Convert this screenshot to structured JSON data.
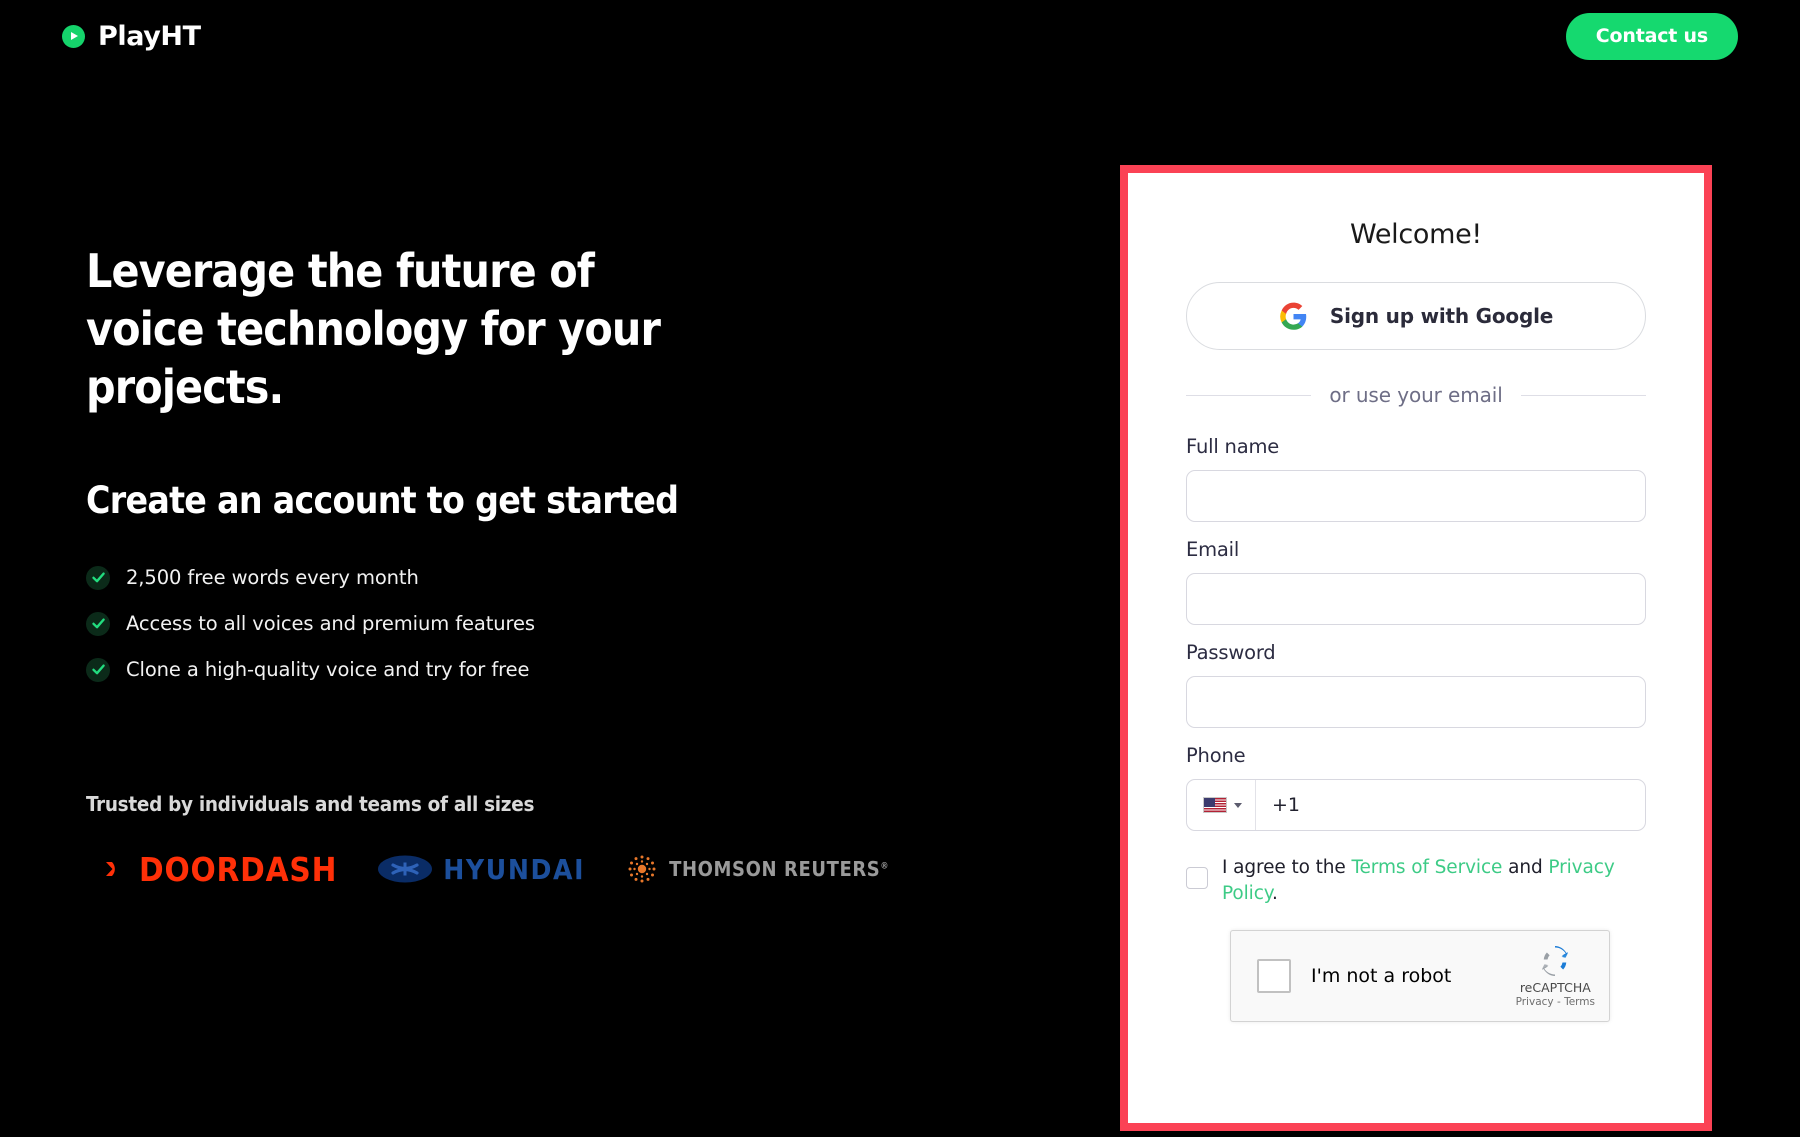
{
  "header": {
    "brand_name": "PlayHT",
    "contact_label": "Contact us"
  },
  "hero": {
    "headline": "Leverage the future of voice technology for your projects.",
    "subheadline": "Create an account to get started",
    "features": [
      "2,500 free words every month",
      "Access to all voices and premium features",
      "Clone a high-quality voice and try for free"
    ],
    "trusted_title": "Trusted by individuals and teams of all sizes",
    "logos": [
      {
        "name": "DoorDash",
        "text": "DOORDASH",
        "color": "#FF3008"
      },
      {
        "name": "Hyundai",
        "text": "HYUNDAI",
        "color": "#1C4F9C"
      },
      {
        "name": "Thomson Reuters",
        "text": "THOMSON REUTERS",
        "color": "#9A9A9A"
      }
    ]
  },
  "signup": {
    "title": "Welcome!",
    "google_button": "Sign up with Google",
    "divider_text": "or use your email",
    "fields": [
      {
        "label": "Full name",
        "value": "",
        "placeholder": ""
      },
      {
        "label": "Email",
        "value": "",
        "placeholder": ""
      },
      {
        "label": "Password",
        "value": "",
        "placeholder": ""
      }
    ],
    "phone": {
      "label": "Phone",
      "country_flag": "us-flag-icon",
      "dial_code": "+1",
      "value": "+1"
    },
    "terms": {
      "prefix": "I agree to the ",
      "link1": "Terms of Service",
      "middle": " and ",
      "link2": "Privacy Policy",
      "suffix": ".",
      "checked": false
    },
    "recaptcha": {
      "label": "I'm not a robot",
      "brand": "reCAPTCHA",
      "legal": "Privacy - Terms",
      "checked": false
    }
  },
  "colors": {
    "brand_green": "#15D96F",
    "card_border_red": "#FB4255",
    "link_green": "#3DCB86",
    "background": "#000000"
  }
}
